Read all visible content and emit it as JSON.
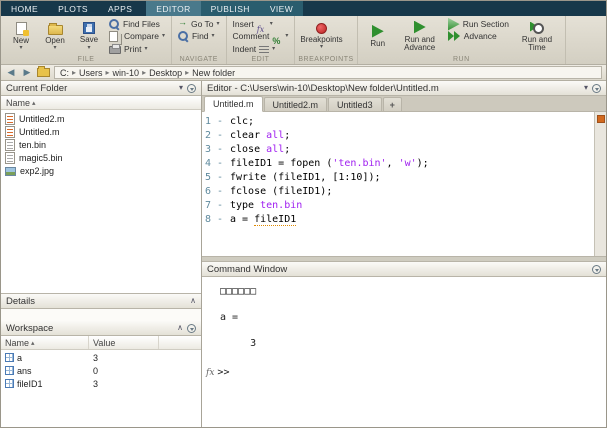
{
  "colors": {
    "ribbon_bg": "#17384a",
    "active_tab": "#49798b",
    "context_tab": "#2a5d6e",
    "string_color": "#a020f0",
    "run_green": "#2f8f2f",
    "warning_orange": "#d2691e"
  },
  "icons": {
    "dropdown": "▾",
    "crumb_sep": "▸",
    "back": "◀",
    "forward": "▶",
    "collapse": "∧",
    "sort": "▴"
  },
  "ribbon": {
    "tabs": [
      {
        "label": "HOME",
        "group": "main",
        "active": false
      },
      {
        "label": "PLOTS",
        "group": "main",
        "active": false
      },
      {
        "label": "APPS",
        "group": "main",
        "active": false
      },
      {
        "label": "EDITOR",
        "group": "context",
        "active": true
      },
      {
        "label": "PUBLISH",
        "group": "context",
        "active": false
      },
      {
        "label": "VIEW",
        "group": "context",
        "active": false
      }
    ]
  },
  "toolstrip": {
    "sections": [
      {
        "label": "FILE",
        "items": [
          {
            "label": "New",
            "icon": "new-file",
            "size": "big",
            "dd": true
          },
          {
            "label": "Open",
            "icon": "open-folder",
            "size": "big",
            "dd": true
          },
          {
            "label": "Save",
            "icon": "save",
            "size": "big",
            "dd": true
          },
          {
            "label": "Find Files",
            "icon": "magnifier",
            "size": "small"
          },
          {
            "label": "Compare",
            "icon": "compare",
            "size": "small",
            "dd": true
          },
          {
            "label": "Print",
            "icon": "printer",
            "size": "small",
            "dd": true
          }
        ]
      },
      {
        "label": "NAVIGATE",
        "items": [
          {
            "label": "Go To",
            "icon": "goto",
            "size": "small",
            "dd": true
          },
          {
            "label": "Find",
            "icon": "magnifier",
            "size": "small",
            "dd": true
          }
        ]
      },
      {
        "label": "EDIT",
        "items": [
          {
            "label": "Insert",
            "icon": "fx",
            "size": "small",
            "dd": true,
            "label_first": true
          },
          {
            "label": "Comment",
            "icon": "percent",
            "size": "small",
            "dd": true,
            "label_first": true
          },
          {
            "label": "Indent",
            "icon": "indent",
            "size": "small",
            "dd": true,
            "label_first": true
          }
        ]
      },
      {
        "label": "BREAKPOINTS",
        "items": [
          {
            "label": "Breakpoints",
            "icon": "breakpoint",
            "size": "big",
            "dd": true
          }
        ]
      },
      {
        "label": "RUN",
        "items": [
          {
            "label": "Run",
            "icon": "run",
            "size": "big"
          },
          {
            "label": "Run and Advance",
            "icon": "run-advance",
            "size": "big"
          },
          {
            "label": "Run Section",
            "icon": "run-section",
            "size": "small"
          },
          {
            "label": "Advance",
            "icon": "advance",
            "size": "small"
          },
          {
            "label": "Run and Time",
            "icon": "run-time",
            "size": "big"
          }
        ]
      }
    ]
  },
  "breadcrumb": {
    "items": [
      "C:",
      "Users",
      "win-10",
      "Desktop",
      "New folder"
    ]
  },
  "current_folder": {
    "title": "Current Folder",
    "name_header": "Name",
    "files": [
      {
        "name": "Untitled2.m",
        "icon": "mfile"
      },
      {
        "name": "Untitled.m",
        "icon": "mfile"
      },
      {
        "name": "ten.bin",
        "icon": "binfile"
      },
      {
        "name": "magic5.bin",
        "icon": "binfile"
      },
      {
        "name": "exp2.jpg",
        "icon": "imgfile"
      }
    ]
  },
  "details": {
    "title": "Details"
  },
  "workspace": {
    "title": "Workspace",
    "columns": [
      "Name",
      "Value"
    ],
    "rows": [
      {
        "name": "a",
        "value": "3"
      },
      {
        "name": "ans",
        "value": "0"
      },
      {
        "name": "fileID1",
        "value": "3"
      }
    ]
  },
  "editor": {
    "title": "Editor - C:\\Users\\win-10\\Desktop\\New folder\\Untitled.m",
    "tabs": [
      {
        "label": "Untitled.m",
        "active": true
      },
      {
        "label": "Untitled2.m",
        "active": false
      },
      {
        "label": "Untitled3",
        "active": false
      },
      {
        "label": "+",
        "active": false,
        "add": true
      }
    ],
    "gutter_suffix": "-",
    "lines": [
      {
        "n": "1",
        "tokens": [
          {
            "t": "clc;",
            "c": "plain"
          }
        ]
      },
      {
        "n": "2",
        "tokens": [
          {
            "t": "clear ",
            "c": "plain"
          },
          {
            "t": "all",
            "c": "string"
          },
          {
            "t": ";",
            "c": "plain"
          }
        ]
      },
      {
        "n": "3",
        "tokens": [
          {
            "t": "close ",
            "c": "plain"
          },
          {
            "t": "all",
            "c": "string"
          },
          {
            "t": ";",
            "c": "plain"
          }
        ]
      },
      {
        "n": "4",
        "tokens": [
          {
            "t": "fileID1 = fopen (",
            "c": "plain"
          },
          {
            "t": "'ten.bin'",
            "c": "string"
          },
          {
            "t": ", ",
            "c": "plain"
          },
          {
            "t": "'w'",
            "c": "string"
          },
          {
            "t": ");",
            "c": "plain"
          }
        ]
      },
      {
        "n": "5",
        "tokens": [
          {
            "t": "fwrite (fileID1, [1:10]);",
            "c": "plain"
          }
        ]
      },
      {
        "n": "6",
        "tokens": [
          {
            "t": "fclose (fileID1);",
            "c": "plain"
          }
        ]
      },
      {
        "n": "7",
        "tokens": [
          {
            "t": "type ",
            "c": "plain"
          },
          {
            "t": "ten.bin",
            "c": "string"
          }
        ]
      },
      {
        "n": "8",
        "tokens": [
          {
            "t": "a = ",
            "c": "plain"
          },
          {
            "t": "fileID1",
            "c": "warn"
          }
        ]
      }
    ]
  },
  "command_window": {
    "title": "Command Window",
    "output": [
      "□□□□□□",
      "",
      "a =",
      "",
      "     3",
      ""
    ],
    "fx": "fx",
    "prompt": ">>"
  }
}
